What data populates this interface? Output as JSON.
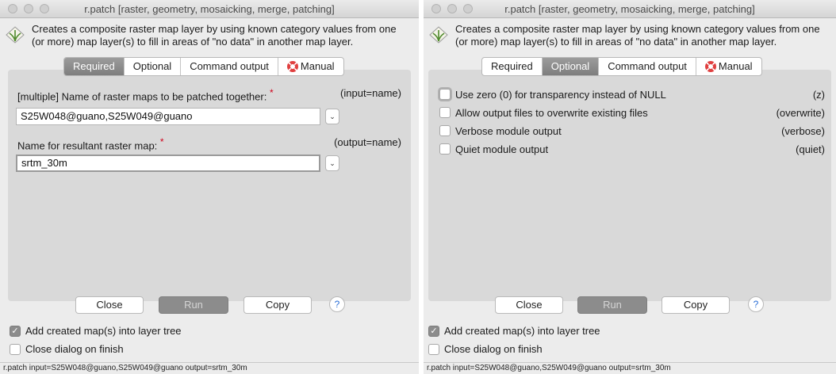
{
  "window_title": "r.patch [raster, geometry, mosaicking, merge, patching]",
  "description_line1": "Creates a composite raster map layer by using known category values from one",
  "description_line2": "(or more) map layer(s) to fill in areas of \"no data\" in another map layer.",
  "tabs": {
    "required": "Required",
    "optional": "Optional",
    "command_output": "Command output",
    "manual": "Manual"
  },
  "left": {
    "active_tab": "Required",
    "input_label": "[multiple] Name of raster maps to be patched together:",
    "input_required_mark": "*",
    "input_param": "(input=name)",
    "input_value": "S25W048@guano,S25W049@guano",
    "output_label": "Name for resultant raster map:",
    "output_required_mark": "*",
    "output_param": "(output=name)",
    "output_value": "srtm_30m"
  },
  "right": {
    "active_tab": "Optional",
    "options": [
      {
        "label": "Use zero (0) for transparency instead of NULL",
        "flag": "(z)",
        "checked": false
      },
      {
        "label": "Allow output files to overwrite existing files",
        "flag": "(overwrite)",
        "checked": false
      },
      {
        "label": "Verbose module output",
        "flag": "(verbose)",
        "checked": false
      },
      {
        "label": "Quiet module output",
        "flag": "(quiet)",
        "checked": false
      }
    ]
  },
  "buttons": {
    "close": "Close",
    "run": "Run",
    "copy": "Copy",
    "help": "?"
  },
  "add_to_layer_tree": {
    "label": "Add created map(s) into layer tree",
    "checked": true
  },
  "close_on_finish": {
    "label": "Close dialog on finish",
    "checked": false
  },
  "status_command": "r.patch input=S25W048@guano,S25W049@guano output=srtm_30m",
  "icons": {
    "module": "grass-icon",
    "manual": "lifering-icon",
    "dropdown": "chevron-down-icon",
    "help": "help-icon"
  },
  "colors": {
    "active_tab": "#8c8c8c",
    "required_mark": "#d0021b",
    "panel": "#d9d9d9",
    "help": "#2b6fd6"
  }
}
